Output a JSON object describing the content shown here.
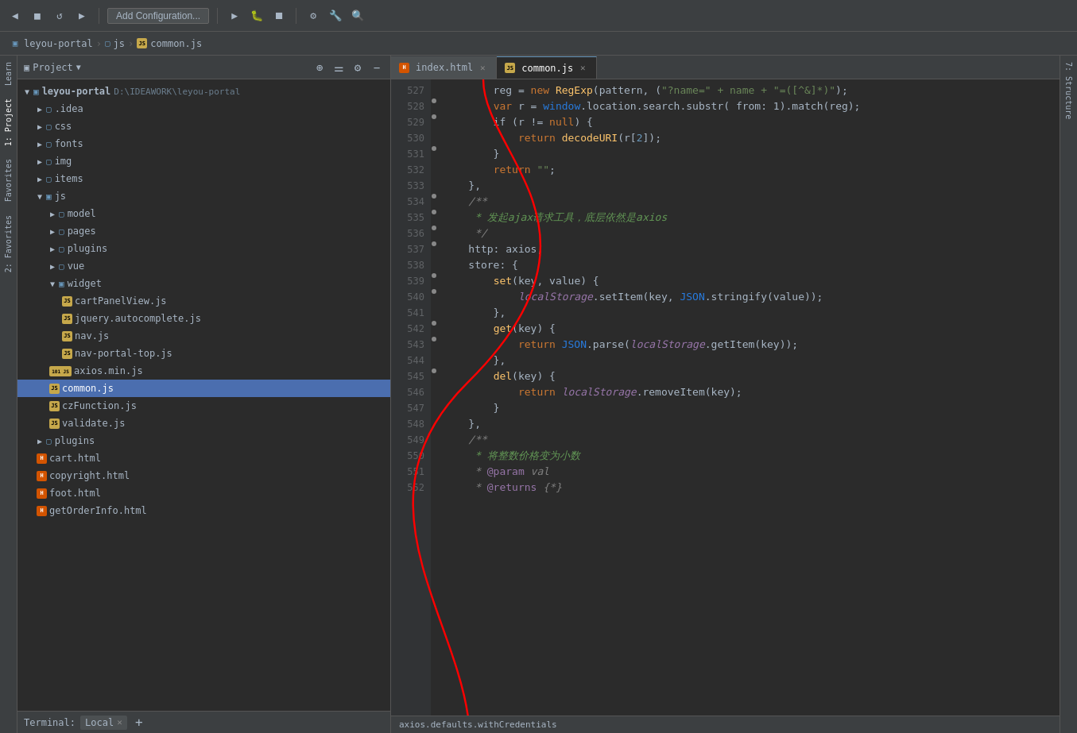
{
  "toolbar": {
    "buttons": [
      "back",
      "forward",
      "refresh",
      "add-config",
      "run",
      "debug",
      "stop",
      "build",
      "settings",
      "search"
    ],
    "add_config_label": "Add Configuration..."
  },
  "breadcrumb": {
    "parts": [
      "leyou-portal",
      "js",
      "common.js"
    ]
  },
  "project_panel": {
    "title": "Project",
    "header_icons": [
      "add-icon",
      "filter-icon",
      "gear-icon",
      "close-icon"
    ],
    "root": {
      "name": "leyou-portal",
      "path": "D:\\IDEAWORK\\leyou-portal"
    },
    "tree": [
      {
        "id": "idea",
        "name": ".idea",
        "type": "folder",
        "level": 1,
        "expanded": false
      },
      {
        "id": "css",
        "name": "css",
        "type": "folder",
        "level": 1,
        "expanded": false
      },
      {
        "id": "fonts",
        "name": "fonts",
        "type": "folder",
        "level": 1,
        "expanded": false
      },
      {
        "id": "img",
        "name": "img",
        "type": "folder",
        "level": 1,
        "expanded": false
      },
      {
        "id": "items",
        "name": "items",
        "type": "folder",
        "level": 1,
        "expanded": false
      },
      {
        "id": "js",
        "name": "js",
        "type": "folder",
        "level": 1,
        "expanded": true
      },
      {
        "id": "model",
        "name": "model",
        "type": "folder",
        "level": 2,
        "expanded": false
      },
      {
        "id": "pages",
        "name": "pages",
        "type": "folder",
        "level": 2,
        "expanded": false
      },
      {
        "id": "plugins",
        "name": "plugins",
        "type": "folder",
        "level": 2,
        "expanded": false
      },
      {
        "id": "vue",
        "name": "vue",
        "type": "folder",
        "level": 2,
        "expanded": false
      },
      {
        "id": "widget",
        "name": "widget",
        "type": "folder",
        "level": 2,
        "expanded": true
      },
      {
        "id": "cartPanelView",
        "name": "cartPanelView.js",
        "type": "js",
        "level": 3
      },
      {
        "id": "jquery.autocomplete",
        "name": "jquery.autocomplete.js",
        "type": "js",
        "level": 3
      },
      {
        "id": "nav",
        "name": "nav.js",
        "type": "js",
        "level": 3
      },
      {
        "id": "nav-portal-top",
        "name": "nav-portal-top.js",
        "type": "js",
        "level": 3
      },
      {
        "id": "axios-min",
        "name": "axios.min.js",
        "type": "js-101",
        "level": 2
      },
      {
        "id": "common",
        "name": "common.js",
        "type": "js",
        "level": 2,
        "selected": true
      },
      {
        "id": "czFunction",
        "name": "czFunction.js",
        "type": "js",
        "level": 2
      },
      {
        "id": "validate",
        "name": "validate.js",
        "type": "js",
        "level": 2
      },
      {
        "id": "plugins-folder",
        "name": "plugins",
        "type": "folder",
        "level": 1,
        "expanded": false
      },
      {
        "id": "cart-html",
        "name": "cart.html",
        "type": "html",
        "level": 1
      },
      {
        "id": "copyright-html",
        "name": "copyright.html",
        "type": "html",
        "level": 1
      },
      {
        "id": "foot-html",
        "name": "foot.html",
        "type": "html",
        "level": 1
      },
      {
        "id": "getOrderInfo-html",
        "name": "getOrderInfo.html",
        "type": "html",
        "level": 1
      }
    ]
  },
  "editor": {
    "tabs": [
      {
        "id": "index-html",
        "name": "index.html",
        "type": "html",
        "active": false
      },
      {
        "id": "common-js",
        "name": "common.js",
        "type": "js",
        "active": true
      }
    ],
    "lines": [
      {
        "num": 527,
        "tokens": [
          {
            "t": "        reg = ",
            "c": "c-variable"
          },
          {
            "t": "new ",
            "c": "c-keyword"
          },
          {
            "t": "RegExp",
            "c": "c-function"
          },
          {
            "t": "(pattern, (",
            "c": "c-variable"
          },
          {
            "t": "'?', + name + '=([^&]*)'",
            "c": "c-string"
          },
          {
            "t": ");",
            "c": "c-variable"
          }
        ]
      },
      {
        "num": 528,
        "tokens": [
          {
            "t": "        ",
            "c": ""
          },
          {
            "t": "var ",
            "c": "c-keyword"
          },
          {
            "t": "r = ",
            "c": "c-variable"
          },
          {
            "t": "window",
            "c": "c-cyan"
          },
          {
            "t": ".location.search.substr(",
            "c": "c-variable"
          },
          {
            "t": "from: 1",
            "c": "c-variable"
          },
          {
            "t": ").match(reg);",
            "c": "c-variable"
          }
        ]
      },
      {
        "num": 529,
        "tokens": [
          {
            "t": "        if (r != ",
            "c": "c-variable"
          },
          {
            "t": "null",
            "c": "c-keyword"
          },
          {
            "t": ") {",
            "c": "c-variable"
          }
        ]
      },
      {
        "num": 530,
        "tokens": [
          {
            "t": "            return ",
            "c": "c-keyword"
          },
          {
            "t": "decodeURI",
            "c": "c-function"
          },
          {
            "t": "(r[",
            "c": "c-variable"
          },
          {
            "t": "2",
            "c": "c-number"
          },
          {
            "t": "]);",
            "c": "c-variable"
          }
        ]
      },
      {
        "num": 531,
        "tokens": [
          {
            "t": "        }",
            "c": "c-variable"
          }
        ]
      },
      {
        "num": 532,
        "tokens": [
          {
            "t": "        return ",
            "c": "c-keyword"
          },
          {
            "t": "\"\"",
            "c": "c-string"
          },
          {
            "t": ";",
            "c": "c-variable"
          }
        ]
      },
      {
        "num": 533,
        "tokens": [
          {
            "t": "    },",
            "c": "c-variable"
          }
        ]
      },
      {
        "num": 534,
        "tokens": [
          {
            "t": "    ",
            "c": ""
          },
          {
            "t": "/**",
            "c": "c-comment"
          }
        ]
      },
      {
        "num": 535,
        "tokens": [
          {
            "t": "     * 发起ajax请求工具，底层依然是axios",
            "c": "c-green"
          }
        ]
      },
      {
        "num": 536,
        "tokens": [
          {
            "t": "     */",
            "c": "c-comment"
          }
        ]
      },
      {
        "num": 537,
        "tokens": [
          {
            "t": "    http: axios,",
            "c": "c-variable"
          }
        ]
      },
      {
        "num": 538,
        "tokens": [
          {
            "t": "    store: {",
            "c": "c-variable"
          }
        ]
      },
      {
        "num": 539,
        "tokens": [
          {
            "t": "        ",
            "c": ""
          },
          {
            "t": "set",
            "c": "c-function"
          },
          {
            "t": "(key, value) {",
            "c": "c-variable"
          }
        ]
      },
      {
        "num": 540,
        "tokens": [
          {
            "t": "            ",
            "c": ""
          },
          {
            "t": "localStorage",
            "c": "c-property"
          },
          {
            "t": ".setItem(key, ",
            "c": "c-variable"
          },
          {
            "t": "JSON",
            "c": "c-cyan"
          },
          {
            "t": ".stringify(value));",
            "c": "c-variable"
          }
        ]
      },
      {
        "num": 541,
        "tokens": [
          {
            "t": "        },",
            "c": "c-variable"
          }
        ]
      },
      {
        "num": 542,
        "tokens": [
          {
            "t": "        ",
            "c": ""
          },
          {
            "t": "get",
            "c": "c-function"
          },
          {
            "t": "(key) {",
            "c": "c-variable"
          }
        ]
      },
      {
        "num": 543,
        "tokens": [
          {
            "t": "            return ",
            "c": "c-keyword"
          },
          {
            "t": "JSON",
            "c": "c-cyan"
          },
          {
            "t": ".parse(",
            "c": "c-variable"
          },
          {
            "t": "localStorage",
            "c": "c-property"
          },
          {
            "t": ".getItem(key));",
            "c": "c-variable"
          }
        ]
      },
      {
        "num": 544,
        "tokens": [
          {
            "t": "        },",
            "c": "c-variable"
          }
        ]
      },
      {
        "num": 545,
        "tokens": [
          {
            "t": "        ",
            "c": ""
          },
          {
            "t": "del",
            "c": "c-function"
          },
          {
            "t": "(key) {",
            "c": "c-variable"
          }
        ]
      },
      {
        "num": 546,
        "tokens": [
          {
            "t": "            return ",
            "c": "c-keyword"
          },
          {
            "t": "localStorage",
            "c": "c-property"
          },
          {
            "t": ".removeItem(key);",
            "c": "c-variable"
          }
        ]
      },
      {
        "num": 547,
        "tokens": [
          {
            "t": "        }",
            "c": "c-variable"
          }
        ]
      },
      {
        "num": 548,
        "tokens": [
          {
            "t": "    },",
            "c": "c-variable"
          }
        ]
      },
      {
        "num": 549,
        "tokens": [
          {
            "t": "    ",
            "c": ""
          },
          {
            "t": "/**",
            "c": "c-comment"
          }
        ]
      },
      {
        "num": 550,
        "tokens": [
          {
            "t": "     * 将整数价格变为小数",
            "c": "c-green"
          }
        ]
      },
      {
        "num": 551,
        "tokens": [
          {
            "t": "     * ",
            "c": "c-comment"
          },
          {
            "t": "@param",
            "c": "c-purple"
          },
          {
            "t": " val",
            "c": "c-italic c-comment"
          }
        ]
      },
      {
        "num": 552,
        "tokens": [
          {
            "t": "     * ",
            "c": "c-comment"
          },
          {
            "t": "@returns",
            "c": "c-purple"
          },
          {
            "t": " {*}",
            "c": "c-italic c-comment"
          }
        ]
      }
    ]
  },
  "side_tabs_left": [
    "Learn",
    "1: Project",
    "Favorites",
    "2: Favorites"
  ],
  "side_tabs_right": [
    "7: Structure"
  ],
  "terminal": {
    "label": "Terminal:",
    "tab_name": "Local",
    "add_label": "+"
  },
  "status_bar": {
    "text": "axios.defaults.withCredentials"
  }
}
